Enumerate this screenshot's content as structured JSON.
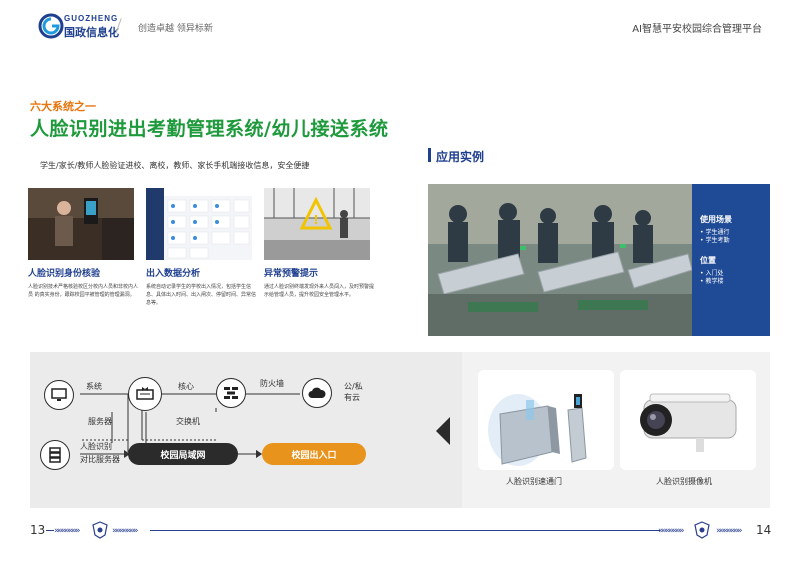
{
  "header": {
    "logo_en": "GUOZHENG",
    "logo_cn": "国政信息化",
    "slogan": "创造卓越  领异标新",
    "platform_title": "AI智慧平安校园综合管理平台"
  },
  "section": {
    "subtitle": "六大系统之一",
    "title": "人脸识别进出考勤管理系统/幼儿接送系统",
    "intro": "学生/家长/教师人脸验证进校、离校，教师、家长手机端接收信息，安全便捷"
  },
  "features": [
    {
      "title": "人脸识别身份核验",
      "desc": "人脸识别技术严格核验校区分校内人员和非校内人员 的真实身份，跟踪校园平被管理的管理漏洞。"
    },
    {
      "title": "出入数据分析",
      "desc": "系统自动记录学生的学校出入情况，包括学生信息、具体出入时间、出入闸次、停留时间、异常信息等。"
    },
    {
      "title": "异常预警提示",
      "desc": "通过人脸识别终端发现外来人员闯入，及时预警提示给管理人员，提升校园安全管理水平。"
    }
  ],
  "application": {
    "title": "应用实例",
    "scene_heading": "使用场景",
    "scene_items": [
      "• 学生通行",
      "• 学生考勤"
    ],
    "location_heading": "位置",
    "location_items": [
      "• 入门处",
      "• 教学楼"
    ]
  },
  "diagram": {
    "system": "系统",
    "server": "服务器",
    "core": "核心",
    "switch": "交换机",
    "firewall": "防火墙",
    "cloud": "公/私\n有云",
    "face_compare_server_1": "人脸识别",
    "face_compare_server_2": "对比服务器",
    "campus_lan": "校园局域网",
    "campus_gate": "校园出入口"
  },
  "products": [
    {
      "caption": "人脸识别速通门"
    },
    {
      "caption": "人脸识别摄像机"
    }
  ],
  "footer": {
    "left_page": "13",
    "right_page": "14",
    "chevrons": "»»»»»»»"
  },
  "colors": {
    "brand_blue": "#1f3f8f",
    "title_green": "#1e9a3c",
    "accent_orange": "#e8740c",
    "panel_blue": "#1f4a96"
  }
}
